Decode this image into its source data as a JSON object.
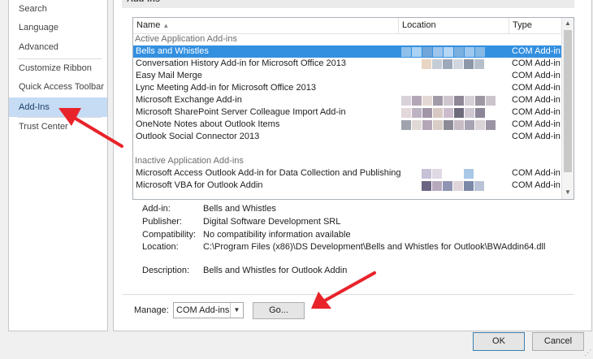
{
  "nav": {
    "items": [
      {
        "label": "Search",
        "selected": false
      },
      {
        "label": "Language",
        "selected": false
      },
      {
        "label": "Advanced",
        "selected": false
      },
      {
        "label": "Customize Ribbon",
        "selected": false
      },
      {
        "label": "Quick Access Toolbar",
        "selected": false
      },
      {
        "label": "Add-Ins",
        "selected": true
      },
      {
        "label": "Trust Center",
        "selected": false
      }
    ]
  },
  "section": {
    "title": "Add-ins"
  },
  "list": {
    "columns": [
      "Name",
      "Location",
      "Type"
    ],
    "sort_indicator": "▲",
    "groups": [
      {
        "label": "Active Application Add-ins",
        "rows": [
          {
            "name": "Bells and Whistles",
            "type": "COM Add-in",
            "selected": true
          },
          {
            "name": "Conversation History Add-in for Microsoft Office 2013",
            "type": "COM Add-in"
          },
          {
            "name": "Easy Mail Merge",
            "type": "COM Add-in"
          },
          {
            "name": "Lync Meeting Add-in for Microsoft Office 2013",
            "type": "COM Add-in"
          },
          {
            "name": "Microsoft Exchange Add-in",
            "type": "COM Add-in"
          },
          {
            "name": "Microsoft SharePoint Server Colleague Import Add-in",
            "type": "COM Add-in"
          },
          {
            "name": "OneNote Notes about Outlook Items",
            "type": "COM Add-in"
          },
          {
            "name": "Outlook Social Connector 2013",
            "type": "COM Add-in"
          }
        ]
      },
      {
        "label": "Inactive Application Add-ins",
        "rows": [
          {
            "name": "Microsoft Access Outlook Add-in for Data Collection and Publishing",
            "type": "COM Add-in"
          },
          {
            "name": "Microsoft VBA for Outlook Addin",
            "type": "COM Add-in"
          }
        ]
      }
    ]
  },
  "details": {
    "addin_label": "Add-in:",
    "addin_value": "Bells and Whistles",
    "publisher_label": "Publisher:",
    "publisher_value": "Digital Software Development SRL",
    "compat_label": "Compatibility:",
    "compat_value": "No compatibility information available",
    "location_label": "Location:",
    "location_value": "C:\\Program Files (x86)\\DS Development\\Bells and Whistles for Outlook\\BWAddin64.dll",
    "description_label": "Description:",
    "description_value": "Bells and Whistles for Outlook Addin"
  },
  "manage": {
    "label": "Manage:",
    "selected": "COM Add-ins",
    "go_label": "Go..."
  },
  "dialog": {
    "ok_label": "OK",
    "cancel_label": "Cancel"
  },
  "colors": {
    "selection": "#3390e0",
    "nav_selected": "#c5dcf4",
    "annotation_arrow": "#e8232a"
  }
}
